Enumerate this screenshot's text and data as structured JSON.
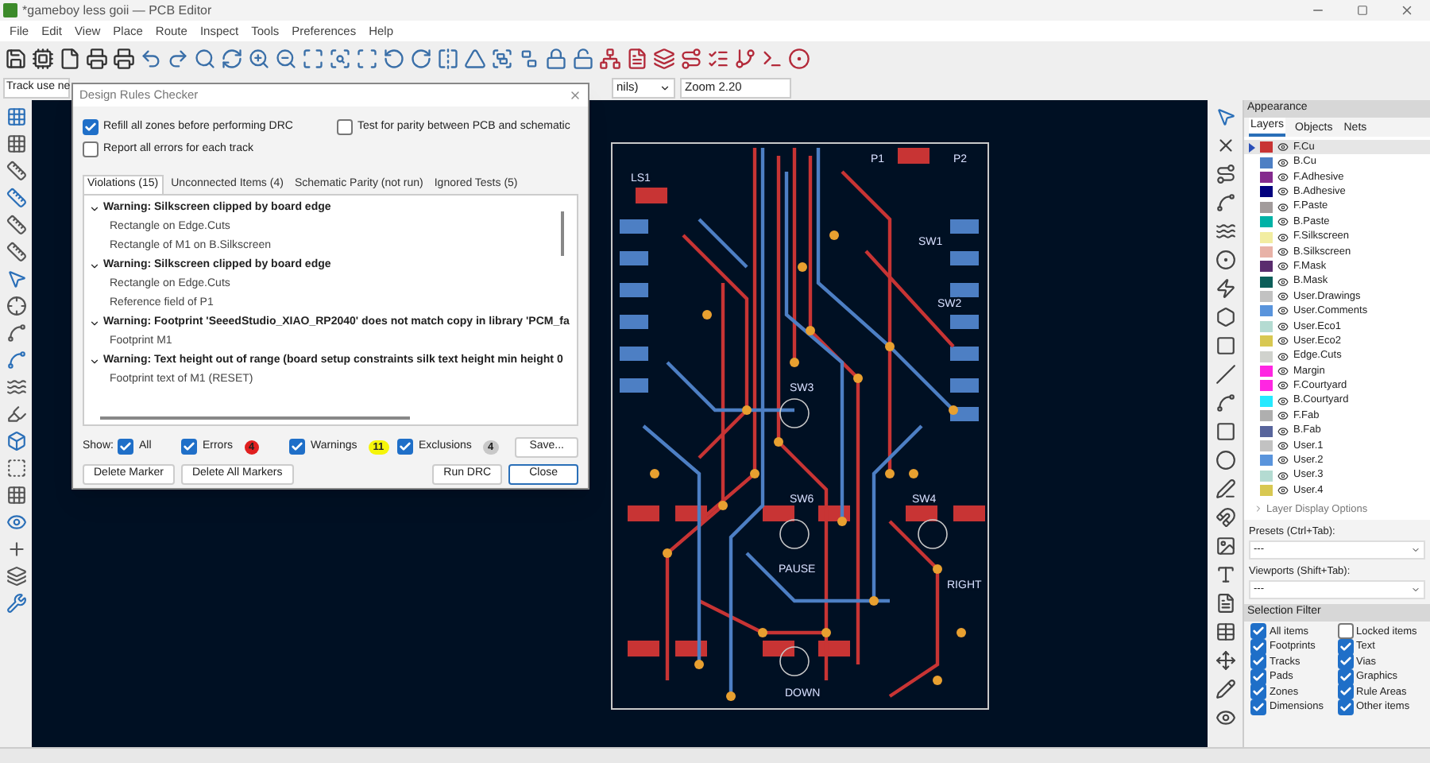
{
  "window": {
    "title": "*gameboy less goii — PCB Editor"
  },
  "menu": [
    "File",
    "Edit",
    "View",
    "Place",
    "Route",
    "Inspect",
    "Tools",
    "Preferences",
    "Help"
  ],
  "aux_toolbar": {
    "track": "Track use ne",
    "units": "nils)",
    "zoom": "Zoom 2.20"
  },
  "drc_dialog": {
    "title": "Design Rules Checker",
    "options": [
      {
        "label": "Refill all zones before performing DRC",
        "checked": true
      },
      {
        "label": "Test for parity between PCB and schematic",
        "checked": false
      },
      {
        "label": "Report all errors for each track",
        "checked": false
      }
    ],
    "tabs": [
      {
        "label": "Violations (15)",
        "selected": true
      },
      {
        "label": "Unconnected Items (4)",
        "selected": false
      },
      {
        "label": "Schematic Parity (not run)",
        "selected": false
      },
      {
        "label": "Ignored Tests (5)",
        "selected": false
      }
    ],
    "violations": [
      {
        "text": "Warning: Silkscreen clipped by board edge",
        "expanded": true,
        "children": [
          {
            "text": "Rectangle on Edge.Cuts"
          },
          {
            "text": "Rectangle of M1 on B.Silkscreen"
          }
        ]
      },
      {
        "text": "Warning: Silkscreen clipped by board edge",
        "expanded": true,
        "children": [
          {
            "text": "Rectangle on Edge.Cuts"
          },
          {
            "text": "Reference field of P1"
          }
        ]
      },
      {
        "text": "Warning: Footprint 'SeeedStudio_XIAO_RP2040' does not match copy in library 'PCM_fa",
        "expanded": true,
        "children": [
          {
            "text": "Footprint M1"
          }
        ]
      },
      {
        "text": "Warning: Text height out of range (board setup constraints silk text height min height 0",
        "expanded": true,
        "children": [
          {
            "text": "Footprint text of M1 (RESET)"
          }
        ]
      }
    ],
    "show_label": "Show:",
    "filters": [
      {
        "label": "All",
        "checked": true
      },
      {
        "label": "Errors",
        "checked": true,
        "count": "4",
        "color": "#e02020"
      },
      {
        "label": "Warnings",
        "checked": true,
        "count": "11",
        "color": "#f5f50a"
      },
      {
        "label": "Exclusions",
        "checked": true,
        "count": "4",
        "color": "#c8c8c8"
      }
    ],
    "save_button": "Save...",
    "buttons": [
      "Delete Marker",
      "Delete All Markers",
      "Run DRC",
      "Close"
    ]
  },
  "board_labels": [
    "P1",
    "P2",
    "LS1",
    "SW1",
    "SW2",
    "SW3",
    "SW6",
    "SW4",
    "PAUSE",
    "RIGHT",
    "DOWN"
  ],
  "appearance": {
    "title": "Appearance",
    "tabs": [
      {
        "label": "Layers",
        "selected": true
      },
      {
        "label": "Objects",
        "selected": false
      },
      {
        "label": "Nets",
        "selected": false
      }
    ],
    "layers": [
      {
        "name": "F.Cu",
        "color": "#c83434",
        "selected": true
      },
      {
        "name": "B.Cu",
        "color": "#4d7fc4",
        "selected": false
      },
      {
        "name": "F.Adhesive",
        "color": "#842a8e",
        "selected": false
      },
      {
        "name": "B.Adhesive",
        "color": "#03017e",
        "selected": false
      },
      {
        "name": "F.Paste",
        "color": "#a29b9b",
        "selected": false
      },
      {
        "name": "B.Paste",
        "color": "#00b2a6",
        "selected": false
      },
      {
        "name": "F.Silkscreen",
        "color": "#f2eda1",
        "selected": false
      },
      {
        "name": "B.Silkscreen",
        "color": "#e8b2a7",
        "selected": false
      },
      {
        "name": "F.Mask",
        "color": "#5a2d6e",
        "selected": false
      },
      {
        "name": "B.Mask",
        "color": "#0d5f5a",
        "selected": false
      },
      {
        "name": "User.Drawings",
        "color": "#c2c2c2",
        "selected": false
      },
      {
        "name": "User.Comments",
        "color": "#5994dc",
        "selected": false
      },
      {
        "name": "User.Eco1",
        "color": "#b4dbd2",
        "selected": false
      },
      {
        "name": "User.Eco2",
        "color": "#d8c852",
        "selected": false
      },
      {
        "name": "Edge.Cuts",
        "color": "#d0d2cd",
        "selected": false
      },
      {
        "name": "Margin",
        "color": "#ff26e2",
        "selected": false
      },
      {
        "name": "F.Courtyard",
        "color": "#ff26e2",
        "selected": false
      },
      {
        "name": "B.Courtyard",
        "color": "#26e9ff",
        "selected": false
      },
      {
        "name": "F.Fab",
        "color": "#afafaf",
        "selected": false
      },
      {
        "name": "B.Fab",
        "color": "#58659c",
        "selected": false
      },
      {
        "name": "User.1",
        "color": "#c2c2c2",
        "selected": false
      },
      {
        "name": "User.2",
        "color": "#5994dc",
        "selected": false
      },
      {
        "name": "User.3",
        "color": "#b4dbd2",
        "selected": false
      },
      {
        "name": "User.4",
        "color": "#d8c852",
        "selected": false
      }
    ],
    "display_options": {
      "label": "Layer Display Options",
      "expanded": false
    },
    "presets": {
      "label": "Presets (Ctrl+Tab):",
      "value": "---"
    },
    "viewports": {
      "label": "Viewports (Shift+Tab):",
      "value": "---"
    }
  },
  "selection_filter": {
    "title": "Selection Filter",
    "items": [
      {
        "label": "All items",
        "checked": true
      },
      {
        "label": "Locked items",
        "checked": false
      },
      {
        "label": "Footprints",
        "checked": true
      },
      {
        "label": "Text",
        "checked": true
      },
      {
        "label": "Tracks",
        "checked": true
      },
      {
        "label": "Vias",
        "checked": true
      },
      {
        "label": "Pads",
        "checked": true
      },
      {
        "label": "Graphics",
        "checked": true
      },
      {
        "label": "Zones",
        "checked": true
      },
      {
        "label": "Rule Areas",
        "checked": true
      },
      {
        "label": "Dimensions",
        "checked": true
      },
      {
        "label": "Other items",
        "checked": true
      }
    ]
  }
}
